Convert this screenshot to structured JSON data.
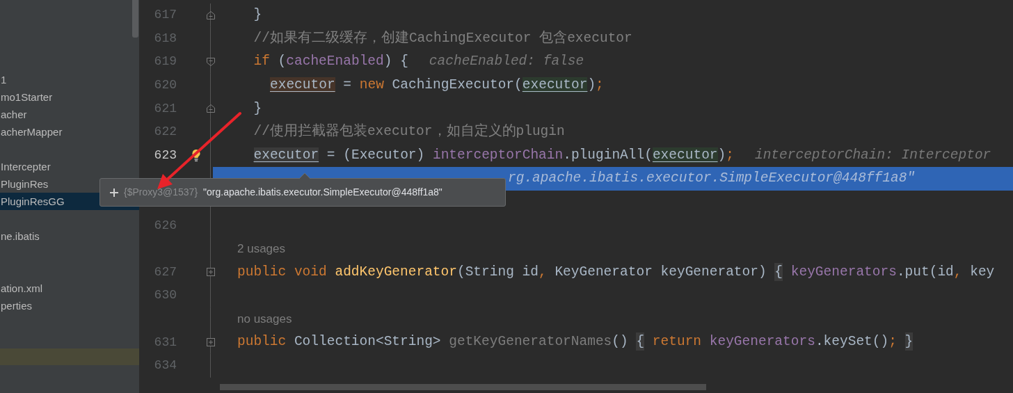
{
  "sidebar": {
    "items": [
      {
        "label": "1",
        "selected": false
      },
      {
        "label": "mo1Starter",
        "selected": false
      },
      {
        "label": "acher",
        "selected": false
      },
      {
        "label": "acherMapper",
        "selected": false
      },
      {
        "label": "Intercepter",
        "selected": false
      },
      {
        "label": "PluginRes",
        "selected": false
      },
      {
        "label": "PluginResGG",
        "selected": true
      },
      {
        "label": "ne.ibatis",
        "selected": false
      },
      {
        "label": "ation.xml",
        "selected": false
      },
      {
        "label": "perties",
        "selected": false
      }
    ]
  },
  "editor": {
    "lines": [
      {
        "kind": "block",
        "children": [
          {
            "kind": "code",
            "number": "617",
            "fold_end": true,
            "tokens": [
              {
                "kind": "plain",
                "text": "}"
              }
            ]
          },
          {
            "kind": "code",
            "number": "618",
            "tokens": [
              {
                "kind": "comment",
                "text": "//如果有二级缓存，创建CachingExecutor 包含executor"
              }
            ]
          },
          {
            "kind": "code",
            "number": "619",
            "fold_start": true,
            "tokens": [
              {
                "kind": "kw",
                "text": "if"
              },
              {
                "kind": "plain",
                "text": " ("
              },
              {
                "kind": "field",
                "text": "cacheEnabled"
              },
              {
                "kind": "plain",
                "text": ") {"
              }
            ],
            "hint": "cacheEnabled: false",
            "children": [
              {
                "kind": "code",
                "number": "620",
                "tokens": [
                  {
                    "kind": "write",
                    "text": "executor"
                  },
                  {
                    "kind": "plain",
                    "text": " = "
                  },
                  {
                    "kind": "kw",
                    "text": "new"
                  },
                  {
                    "kind": "plain",
                    "text": " CachingExecutor("
                  },
                  {
                    "kind": "read",
                    "text": "executor"
                  },
                  {
                    "kind": "plain",
                    "text": ")"
                  },
                  {
                    "kind": "punct",
                    "text": ";"
                  }
                ]
              }
            ]
          },
          {
            "kind": "code",
            "number": "621",
            "fold_end": true,
            "tokens": [
              {
                "kind": "plain",
                "text": "}"
              }
            ]
          },
          {
            "kind": "code",
            "number": "622",
            "tokens": [
              {
                "kind": "comment",
                "text": "//使用拦截器包装executor，如自定义的plugin"
              }
            ]
          },
          {
            "kind": "code",
            "number": "623",
            "current": true,
            "intention": true,
            "tokens": [
              {
                "kind": "ref",
                "text": "executor"
              },
              {
                "kind": "plain",
                "text": " = (Executor) "
              },
              {
                "kind": "field",
                "text": "interceptorChain"
              },
              {
                "kind": "plain",
                "text": ".pluginAll("
              },
              {
                "kind": "read",
                "text": "executor"
              },
              {
                "kind": "plain",
                "text": ")"
              },
              {
                "kind": "punct",
                "text": ";"
              }
            ],
            "hint": "interceptorChain: Interceptor"
          }
        ]
      },
      {
        "kind": "covered",
        "selected": true,
        "tokens": [
          {
            "kind": "value",
            "text": "rg.apache.ibatis.executor.SimpleExecutor@448ff1a8\""
          }
        ]
      },
      {
        "kind": "covered",
        "selected": false
      },
      {
        "kind": "code",
        "number": "626"
      },
      {
        "kind": "usages",
        "text": "2 usages"
      },
      {
        "kind": "code",
        "number": "627",
        "collapsed": true,
        "tokens": [
          {
            "kind": "kw",
            "text": "public void "
          },
          {
            "kind": "fn",
            "text": "addKeyGenerator"
          },
          {
            "kind": "plain",
            "text": "(String id"
          },
          {
            "kind": "punct",
            "text": ","
          },
          {
            "kind": "plain",
            "text": " KeyGenerator keyGenerator) "
          },
          {
            "kind": "brace",
            "text": "{"
          },
          {
            "kind": "field",
            "text": " keyGenerators"
          },
          {
            "kind": "plain",
            "text": ".put(id"
          },
          {
            "kind": "punct",
            "text": ","
          },
          {
            "kind": "plain",
            "text": " key"
          }
        ]
      },
      {
        "kind": "code",
        "number": "630"
      },
      {
        "kind": "usages",
        "text": "no usages"
      },
      {
        "kind": "code",
        "number": "631",
        "collapsed": true,
        "tokens": [
          {
            "kind": "kw",
            "text": "public "
          },
          {
            "kind": "plain",
            "text": "Collection<String> "
          },
          {
            "kind": "unused",
            "text": "getKeyGeneratorNames"
          },
          {
            "kind": "plain",
            "text": "() "
          },
          {
            "kind": "brace",
            "text": "{"
          },
          {
            "kind": "kw",
            "text": " return "
          },
          {
            "kind": "field",
            "text": "keyGenerators"
          },
          {
            "kind": "plain",
            "text": ".keySet()"
          },
          {
            "kind": "punct",
            "text": "; "
          },
          {
            "kind": "brace",
            "text": "}"
          }
        ]
      },
      {
        "kind": "code",
        "number": "634"
      }
    ]
  },
  "tooltip": {
    "object_id": "{$Proxy3@1537}",
    "value": "\"org.apache.ibatis.executor.SimpleExecutor@448ff1a8\""
  }
}
